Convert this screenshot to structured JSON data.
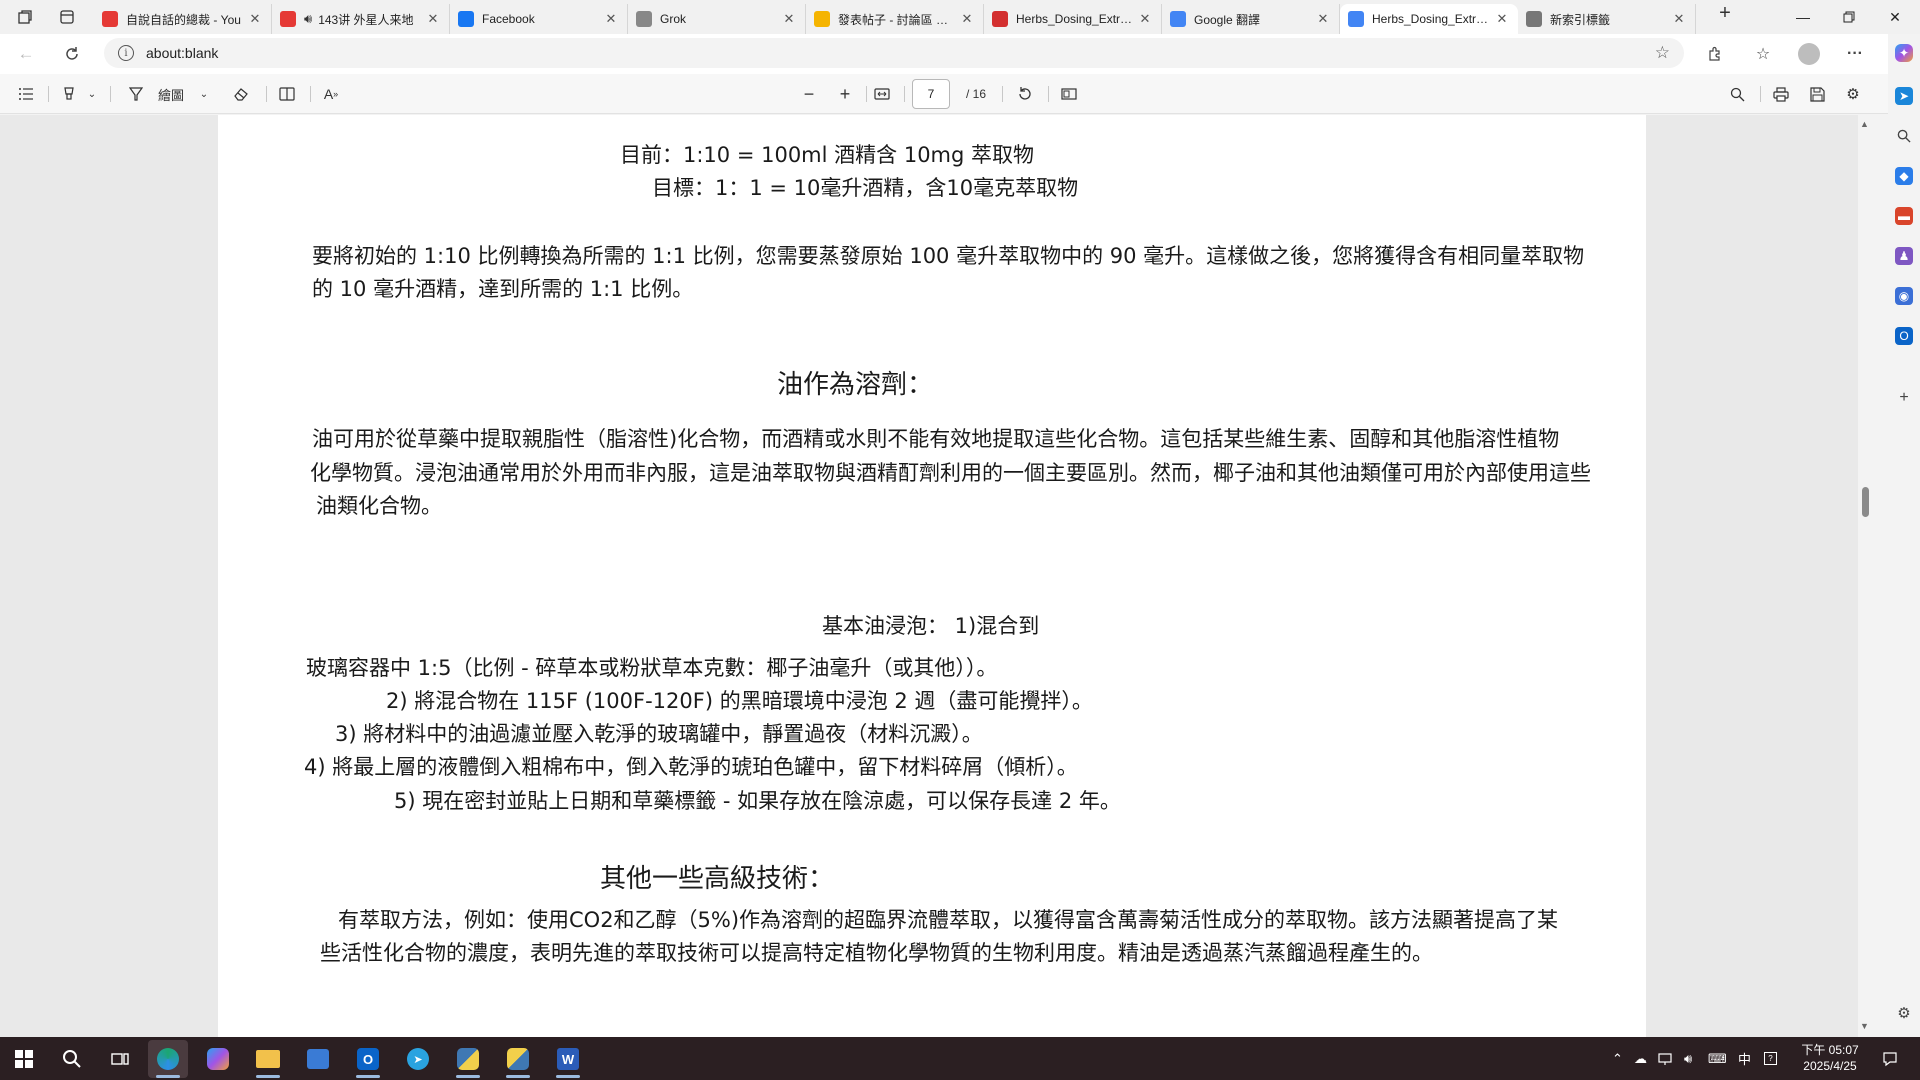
{
  "tabs": [
    {
      "title": "自說自話的總裁 - You",
      "favicon": "youtube-icon",
      "color": "#e53935"
    },
    {
      "title": "143讲 外星人来地",
      "favicon": "youtube-icon",
      "color": "#e53935",
      "audio": true
    },
    {
      "title": "Facebook",
      "favicon": "facebook-icon",
      "color": "#1877f2"
    },
    {
      "title": "Grok",
      "favicon": "grok-icon",
      "color": "#888888"
    },
    {
      "title": "發表帖子 - 討論區 墨新",
      "favicon": "forum-icon",
      "color": "#f5b400"
    },
    {
      "title": "Herbs_Dosing_Extracti",
      "favicon": "pdf-icon",
      "color": "#d32f2f"
    },
    {
      "title": "Google 翻譯",
      "favicon": "google-translate-icon",
      "color": "#4285f4"
    },
    {
      "title": "Herbs_Dosing_Extracti",
      "favicon": "pdf-translate-icon",
      "color": "#4285f4",
      "active": true
    },
    {
      "title": "新索引標籤",
      "favicon": "newtab-icon",
      "color": "#777777"
    }
  ],
  "address": {
    "url": "about:blank"
  },
  "pdf_toolbar": {
    "draw_label": "繪圖",
    "page_current": "7",
    "page_total": "/ 16"
  },
  "document": {
    "lines": [
      "目前：1:10 = 100ml 酒精含 10mg 萃取物",
      "目標：1：1 = 10毫升酒精，含10毫克萃取物",
      "要將初始的 1:10 比例轉換為所需的 1:1 比例，您需要蒸發原始 100 毫升萃取物中的 90 毫升。這樣做之後，您將獲得含有相同量萃取物",
      "的 10 毫升酒精，達到所需的 1:1 比例。",
      "油作為溶劑：",
      "油可用於從草藥中提取親脂性（脂溶性)化合物，而酒精或水則不能有效地提取這些化合物。這包括某些維生素、固醇和其他脂溶性植物",
      "化學物質。浸泡油通常用於外用而非內服，這是油萃取物與酒精酊劑利用的一個主要區別。然而，椰子油和其他油類僅可用於內部使用這些",
      "油類化合物。",
      "基本油浸泡： 1)混合到",
      "玻璃容器中 1:5（比例 - 碎草本或粉狀草本克數：椰子油毫升（或其他））。",
      "2) 將混合物在 115F (100F-120F) 的黑暗環境中浸泡 2 週（盡可能攪拌）。",
      "3) 將材料中的油過濾並壓入乾淨的玻璃罐中，靜置過夜（材料沉澱）。",
      "4) 將最上層的液體倒入粗棉布中，倒入乾淨的琥珀色罐中，留下材料碎屑（傾析）。",
      "5) 現在密封並貼上日期和草藥標籤 - 如果存放在陰涼處，可以保存長達 2 年。",
      "其他一些高級技術：",
      "有萃取方法，例如：使用CO2和乙醇（5%)作為溶劑的超臨界流體萃取，以獲得富含萬壽菊活性成分的萃取物。該方法顯著提高了某",
      "些活性化合物的濃度，表明先進的萃取技術可以提高特定植物化學物質的生物利用度。精油是透過蒸汽蒸餾過程產生的。"
    ]
  },
  "taskbar": {
    "apps": [
      "start-icon",
      "search-icon",
      "task-view-icon",
      "edge-icon",
      "copilot-icon",
      "file-explorer-icon",
      "store-icon",
      "outlook-icon",
      "telegram-icon",
      "python-icon",
      "python-idle-icon",
      "word-icon"
    ],
    "ime": "中",
    "time": "下午 05:07",
    "date": "2025/4/25"
  }
}
